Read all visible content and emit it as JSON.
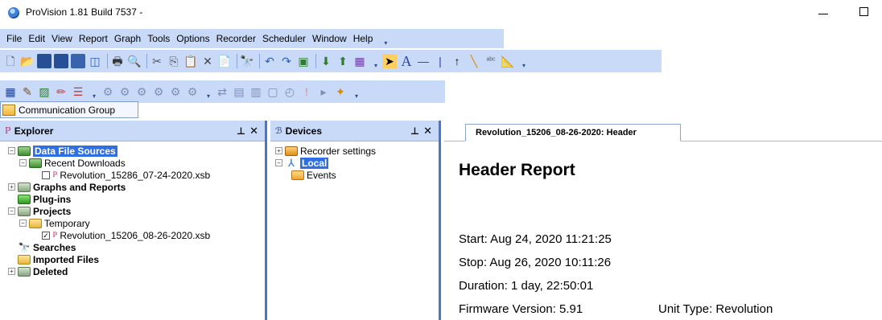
{
  "window": {
    "title": "ProVision 1.81 Build 7537 -"
  },
  "menu": [
    {
      "label": "File"
    },
    {
      "label": "Edit"
    },
    {
      "label": "View"
    },
    {
      "label": "Report"
    },
    {
      "label": "Graph"
    },
    {
      "label": "Tools"
    },
    {
      "label": "Options"
    },
    {
      "label": "Recorder"
    },
    {
      "label": "Scheduler"
    },
    {
      "label": "Window"
    },
    {
      "label": "Help"
    }
  ],
  "commgroup": {
    "label": "Communication Group"
  },
  "explorer": {
    "title": "Explorer",
    "tree": {
      "data_file_sources": "Data File Sources",
      "recent_downloads": "Recent Downloads",
      "recent_file": "Revolution_15286_07-24-2020.xsb",
      "graphs_reports": "Graphs and Reports",
      "plugins": "Plug-ins",
      "projects": "Projects",
      "temporary": "Temporary",
      "temporary_file": "Revolution_15206_08-26-2020.xsb",
      "searches": "Searches",
      "imported_files": "Imported Files",
      "deleted": "Deleted"
    }
  },
  "devices": {
    "title": "Devices",
    "tree": {
      "recorder_settings": "Recorder settings",
      "local": "Local",
      "events": "Events"
    }
  },
  "document": {
    "tab_label": "Revolution_15206_08-26-2020: Header",
    "heading": "Header Report",
    "start": "Start: Aug 24, 2020 11:21:25",
    "stop": "Stop: Aug 26, 2020 10:11:26",
    "duration": "Duration: 1 day, 22:50:01",
    "firmware": "Firmware Version: 5.91",
    "unit_type": "Unit Type:  Revolution"
  }
}
